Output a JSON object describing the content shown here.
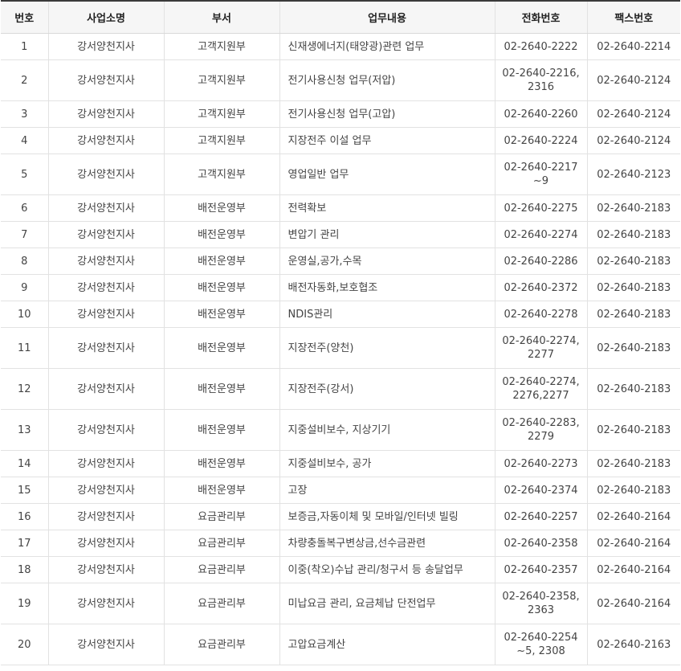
{
  "columns": [
    "번호",
    "사업소명",
    "부서",
    "업무내용",
    "전화번호",
    "팩스번호"
  ],
  "rows": [
    {
      "no": "1",
      "office": "강서양천지사",
      "dept": "고객지원부",
      "task": "신재생에너지(태양광)관련 업무",
      "phone": "02-2640-2222",
      "fax": "02-2640-2214"
    },
    {
      "no": "2",
      "office": "강서양천지사",
      "dept": "고객지원부",
      "task": "전기사용신청 업무(저압)",
      "phone": "02-2640-2216, 2316",
      "fax": "02-2640-2124"
    },
    {
      "no": "3",
      "office": "강서양천지사",
      "dept": "고객지원부",
      "task": "전기사용신청 업무(고압)",
      "phone": "02-2640-2260",
      "fax": "02-2640-2124"
    },
    {
      "no": "4",
      "office": "강서양천지사",
      "dept": "고객지원부",
      "task": "지장전주 이설 업무",
      "phone": "02-2640-2224",
      "fax": "02-2640-2124"
    },
    {
      "no": "5",
      "office": "강서양천지사",
      "dept": "고객지원부",
      "task": "영업일반 업무",
      "phone": "02-2640-2217 ~9",
      "fax": "02-2640-2123"
    },
    {
      "no": "6",
      "office": "강서양천지사",
      "dept": "배전운영부",
      "task": "전력확보",
      "phone": "02-2640-2275",
      "fax": "02-2640-2183"
    },
    {
      "no": "7",
      "office": "강서양천지사",
      "dept": "배전운영부",
      "task": "변압기 관리",
      "phone": "02-2640-2274",
      "fax": "02-2640-2183"
    },
    {
      "no": "8",
      "office": "강서양천지사",
      "dept": "배전운영부",
      "task": "운영실,공가,수목",
      "phone": "02-2640-2286",
      "fax": "02-2640-2183"
    },
    {
      "no": "9",
      "office": "강서양천지사",
      "dept": "배전운영부",
      "task": "배전자동화,보호협조",
      "phone": "02-2640-2372",
      "fax": "02-2640-2183"
    },
    {
      "no": "10",
      "office": "강서양천지사",
      "dept": "배전운영부",
      "task": "NDIS관리",
      "phone": "02-2640-2278",
      "fax": "02-2640-2183"
    },
    {
      "no": "11",
      "office": "강서양천지사",
      "dept": "배전운영부",
      "task": "지장전주(양천)",
      "phone": "02-2640-2274, 2277",
      "fax": "02-2640-2183"
    },
    {
      "no": "12",
      "office": "강서양천지사",
      "dept": "배전운영부",
      "task": "지장전주(강서)",
      "phone": "02-2640-2274, 2276,2277",
      "fax": "02-2640-2183"
    },
    {
      "no": "13",
      "office": "강서양천지사",
      "dept": "배전운영부",
      "task": "지중설비보수, 지상기기",
      "phone": "02-2640-2283, 2279",
      "fax": "02-2640-2183"
    },
    {
      "no": "14",
      "office": "강서양천지사",
      "dept": "배전운영부",
      "task": "지중설비보수, 공가",
      "phone": "02-2640-2273",
      "fax": "02-2640-2183"
    },
    {
      "no": "15",
      "office": "강서양천지사",
      "dept": "배전운영부",
      "task": "고장",
      "phone": "02-2640-2374",
      "fax": "02-2640-2183"
    },
    {
      "no": "16",
      "office": "강서양천지사",
      "dept": "요금관리부",
      "task": "보증금,자동이체 및 모바일/인터넷 빌링",
      "phone": "02-2640-2257",
      "fax": "02-2640-2164"
    },
    {
      "no": "17",
      "office": "강서양천지사",
      "dept": "요금관리부",
      "task": "차량충돌복구변상금,선수금관련",
      "phone": "02-2640-2358",
      "fax": "02-2640-2164"
    },
    {
      "no": "18",
      "office": "강서양천지사",
      "dept": "요금관리부",
      "task": "이중(착오)수납 관리/청구서 등 송달업무",
      "phone": "02-2640-2357",
      "fax": "02-2640-2164"
    },
    {
      "no": "19",
      "office": "강서양천지사",
      "dept": "요금관리부",
      "task": "미납요금 관리, 요금체납 단전업무",
      "phone": "02-2640-2358, 2363",
      "fax": "02-2640-2164"
    },
    {
      "no": "20",
      "office": "강서양천지사",
      "dept": "요금관리부",
      "task": "고압요금계산",
      "phone": "02-2640-2254 ~5, 2308",
      "fax": "02-2640-2163"
    }
  ]
}
